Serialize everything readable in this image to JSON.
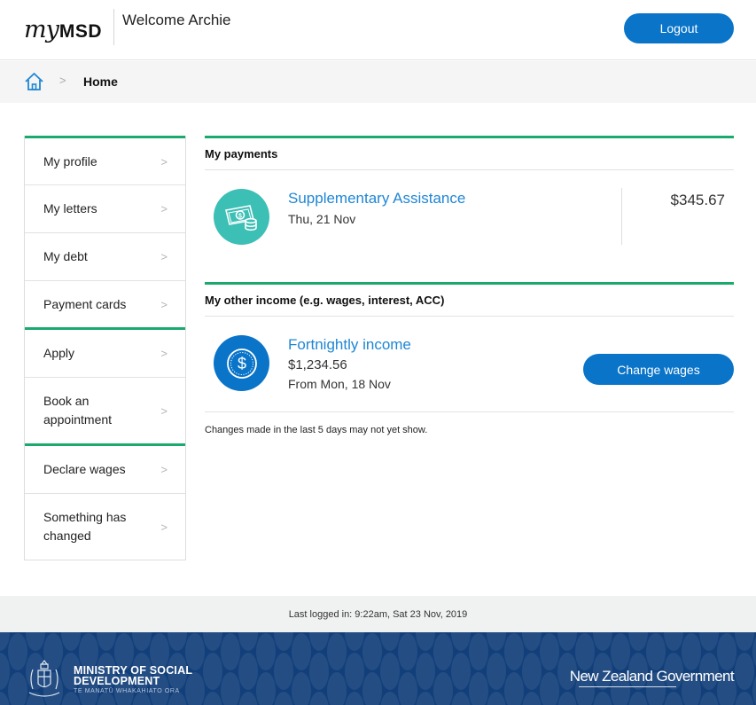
{
  "header": {
    "logo_my": "my",
    "logo_msd": "MSD",
    "welcome": "Welcome Archie",
    "logout_label": "Logout"
  },
  "breadcrumb": {
    "home_icon": "home-icon",
    "separator": ">",
    "current": "Home"
  },
  "sidebar": {
    "items": [
      {
        "label": "My profile"
      },
      {
        "label": "My letters"
      },
      {
        "label": "My debt"
      },
      {
        "label": "Payment cards"
      },
      {
        "label": "Apply"
      },
      {
        "label": "Book an appointment"
      },
      {
        "label": "Declare wages"
      },
      {
        "label": "Something has changed"
      }
    ],
    "chevron": ">"
  },
  "payments": {
    "heading": "My payments",
    "items": [
      {
        "icon": "money-icon",
        "title": "Supplementary Assistance",
        "date": "Thu, 21 Nov",
        "amount": "$345.67"
      }
    ]
  },
  "other_income": {
    "heading": "My other income (e.g. wages, interest, ACC)",
    "items": [
      {
        "icon": "dollar-coin-icon",
        "title": "Fortnightly income",
        "amount": "$1,234.56",
        "from": "From Mon, 18 Nov",
        "button_label": "Change wages"
      }
    ],
    "note": "Changes made in the last 5 days may not yet show."
  },
  "footer": {
    "last_logged_in": "Last logged in: 9:22am, Sat 23 Nov, 2019",
    "ministry_line1": "MINISTRY OF SOCIAL",
    "ministry_line2": "DEVELOPMENT",
    "ministry_sub": "TE MANATŪ WHAKAHIATO ORA",
    "nz_gov": "New Zealand Government"
  },
  "colors": {
    "accent_green": "#1aaa6e",
    "primary_blue": "#0a74c8",
    "link_blue": "#1f86d4",
    "teal": "#3cbfb5",
    "footer_navy": "#123f7a"
  }
}
